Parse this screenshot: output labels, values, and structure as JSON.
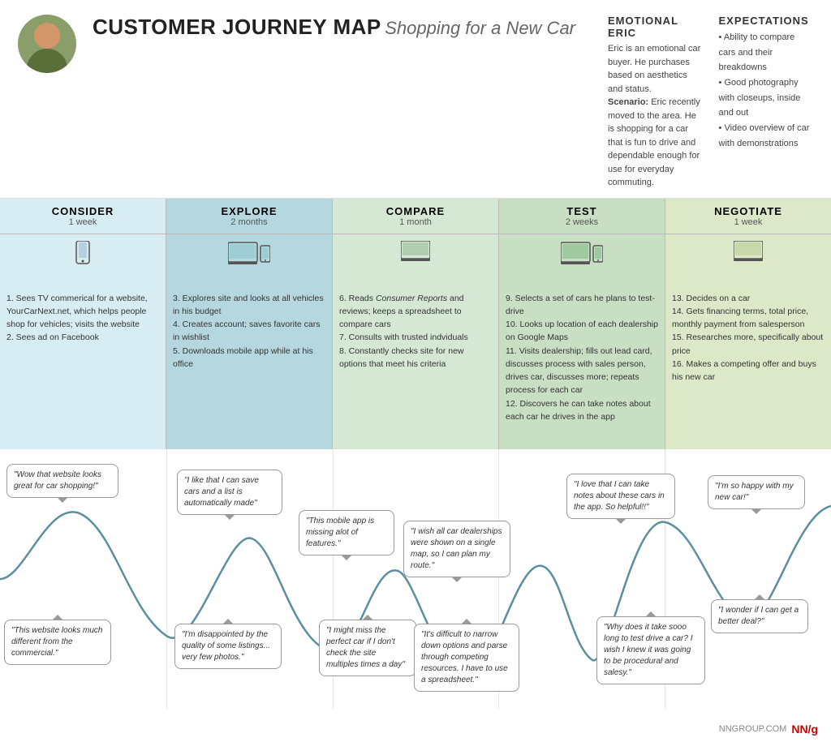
{
  "header": {
    "title_bold": "CUSTOMER JOURNEY MAP",
    "title_italic": "Shopping for a New Car",
    "persona_name": "EMOTIONAL ERIC",
    "persona_desc": "Eric is an emotional car buyer. He purchases based on aesthetics and status.",
    "persona_scenario": "Scenario: Eric recently moved to the area. He is shopping for a car that is fun to drive and dependable enough for use for everyday commuting.",
    "expectations_title": "EXPECTATIONS",
    "expectations": [
      "Ability to compare cars and their breakdowns",
      "Good photography with closeups, inside and out",
      "Video overview of car with demonstrations"
    ]
  },
  "phases": [
    {
      "id": "consider",
      "name": "CONSIDER",
      "duration": "1 week",
      "icon": "📱",
      "color_class": "phase-consider",
      "steps": [
        "1. Sees TV commerical for a website, YourCarNext.net, which helps people shop for vehicles; visits the website",
        "2. Sees ad on Facebook"
      ]
    },
    {
      "id": "explore",
      "name": "EXPLORE",
      "duration": "2 months",
      "icon": "💻📱",
      "color_class": "phase-explore",
      "steps": [
        "3. Explores site and looks at all vehicles in his budget",
        "4. Creates account; saves favorite cars in wishlist",
        "5. Downloads mobile app while at his office"
      ]
    },
    {
      "id": "compare",
      "name": "COMPARE",
      "duration": "1 month",
      "icon": "💻",
      "color_class": "phase-compare",
      "steps": [
        "6. Reads Consumer Reports and reviews; keeps a spreadsheet to compare cars",
        "7. Consults with trusted indviduals",
        "8. Constantly checks site for new options that meet his criteria"
      ]
    },
    {
      "id": "test",
      "name": "TEST",
      "duration": "2 weeks",
      "icon": "💻📱",
      "color_class": "phase-test",
      "steps": [
        "9. Selects a set of cars he plans to test-drive",
        "10. Looks up location of each dealership on Google Maps",
        "11. Visits dealership; fills out lead card, discusses process with sales person, drives car, discusses more; repeats process for each car",
        "12. Discovers he can take notes about each car he drives in the app"
      ]
    },
    {
      "id": "negotiate",
      "name": "NEGOTIATE",
      "duration": "1 week",
      "icon": "💻",
      "color_class": "phase-negotiate",
      "steps": [
        "13. Decides on a car",
        "14. Gets financing terms, total price, monthly payment from salesperson",
        "15. Researches more, specifically about price",
        "16. Makes a competing offer and buys his new car"
      ]
    }
  ],
  "bubbles": [
    {
      "id": "b1",
      "text": "\"Wow that website looks great for car shopping!\"",
      "pos": "high-positive"
    },
    {
      "id": "b2",
      "text": "\"This website looks much different from the commercial.\"",
      "pos": "negative-consider"
    },
    {
      "id": "b3",
      "text": "\"I like that I can save cars and a list is automatically made\"",
      "pos": "positive-explore"
    },
    {
      "id": "b4",
      "text": "\"I'm disappointed by the quality of some listings... very few photos.\"",
      "pos": "negative-explore"
    },
    {
      "id": "b5",
      "text": "\"This mobile app is missing alot of features.\"",
      "pos": "mid-explore"
    },
    {
      "id": "b6",
      "text": "\"I might miss the perfect car if I don't check the site multiples times a day\"",
      "pos": "negative-compare-low"
    },
    {
      "id": "b7",
      "text": "\"I wish all car dealerships were shown on a single map, so I can plan my route.\"",
      "pos": "mid-compare"
    },
    {
      "id": "b8",
      "text": "\"It's difficult to narrow down options and parse through competing resources. I have to use a spreadsheet.\"",
      "pos": "low-compare"
    },
    {
      "id": "b9",
      "text": "\"I love that I can take notes about these cars in the app. So helpful!!\"",
      "pos": "positive-test"
    },
    {
      "id": "b10",
      "text": "\"Why does it take sooo long to test drive a car? I wish I knew it was going to be procedural and salesy.\"",
      "pos": "negative-test"
    },
    {
      "id": "b11",
      "text": "\"I'm so happy with my new car!\"",
      "pos": "positive-negotiate"
    },
    {
      "id": "b12",
      "text": "\"I wonder if I can get a better deal?\"",
      "pos": "negative-negotiate"
    }
  ],
  "footer": {
    "website": "NNGROUP.COM",
    "logo": "NN/g"
  }
}
